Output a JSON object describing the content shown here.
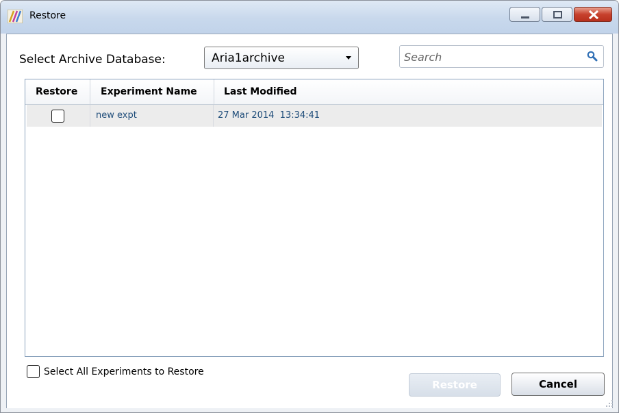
{
  "window": {
    "title": "Restore",
    "controls": {
      "minimize": "minimize-icon",
      "maximize": "maximize-icon",
      "close": "close-icon"
    }
  },
  "archive": {
    "label": "Select Archive Database:",
    "selected": "Aria1archive"
  },
  "search": {
    "placeholder": "Search"
  },
  "table": {
    "columns": [
      "Restore",
      "Experiment Name",
      "Last Modified"
    ],
    "rows": [
      {
        "restore": false,
        "name": "new expt",
        "modified": "27 Mar 2014  13:34:41"
      }
    ]
  },
  "footer": {
    "select_all_label": "Select All Experiments to Restore",
    "restore_label": "Restore",
    "cancel_label": "Cancel"
  },
  "colors": {
    "row_text": "#1f4d7a",
    "title_gradient": "#c8d8ec",
    "close_red": "#c7412d"
  }
}
